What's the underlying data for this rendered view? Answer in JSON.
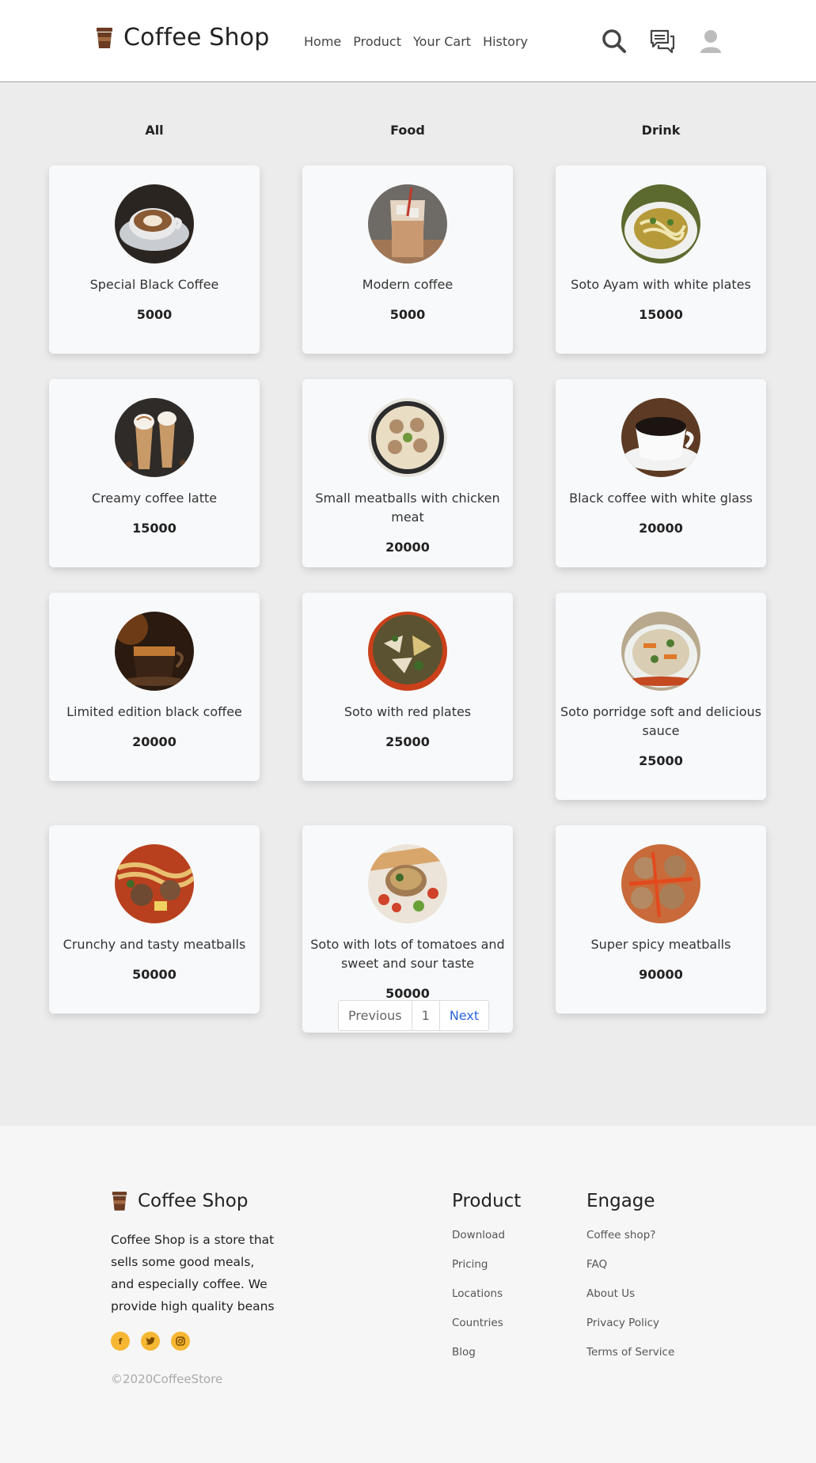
{
  "brand": {
    "title": "Coffee Shop"
  },
  "nav": {
    "links": [
      "Home",
      "Product",
      "Your Cart",
      "History"
    ]
  },
  "tabs": [
    "All",
    "Food",
    "Drink"
  ],
  "products": [
    {
      "name": "Special Black Coffee",
      "price": "5000",
      "image": "latte-art-coffee"
    },
    {
      "name": "Modern coffee",
      "price": "5000",
      "image": "iced-coffee"
    },
    {
      "name": "Soto Ayam with white plates",
      "price": "15000",
      "image": "chicken-soup"
    },
    {
      "name": "Creamy coffee latte",
      "price": "15000",
      "image": "frappe-glasses"
    },
    {
      "name": "Small meatballs with chicken meat",
      "price": "20000",
      "image": "meatball-soup"
    },
    {
      "name": "Black coffee with white glass",
      "price": "20000",
      "image": "black-coffee-cup"
    },
    {
      "name": "Limited edition black coffee",
      "price": "20000",
      "image": "espresso-glass"
    },
    {
      "name": "Soto with red plates",
      "price": "25000",
      "image": "soto-red-plate"
    },
    {
      "name": "Soto porridge soft and delicious sauce",
      "price": "25000",
      "image": "porridge-bowl"
    },
    {
      "name": "Crunchy and tasty meatballs",
      "price": "50000",
      "image": "meatball-noodle"
    },
    {
      "name": "Soto with lots of tomatoes and sweet and sour taste",
      "price": "50000",
      "image": "tomato-soto"
    },
    {
      "name": "Super spicy meatballs",
      "price": "90000",
      "image": "spicy-meatballs"
    }
  ],
  "pagination": {
    "previous": "Previous",
    "page": "1",
    "next": "Next"
  },
  "footer": {
    "brand": "Coffee Shop",
    "description": "Coffee Shop is a store that sells some good meals, and especially coffee. We provide high quality beans",
    "socials": [
      "facebook-icon",
      "twitter-icon",
      "instagram-icon"
    ],
    "copyright": "©2020CoffeeStore",
    "product": {
      "title": "Product",
      "links": [
        "Download",
        "Pricing",
        "Locations",
        "Countries",
        "Blog"
      ]
    },
    "engage": {
      "title": "Engage",
      "links": [
        "Coffee shop?",
        "FAQ",
        "About Us",
        "Privacy Policy",
        "Terms of Service"
      ]
    }
  },
  "colors": {
    "accent": "#f6b733",
    "link": "#2a66d8",
    "brand": "#6b3b22"
  }
}
